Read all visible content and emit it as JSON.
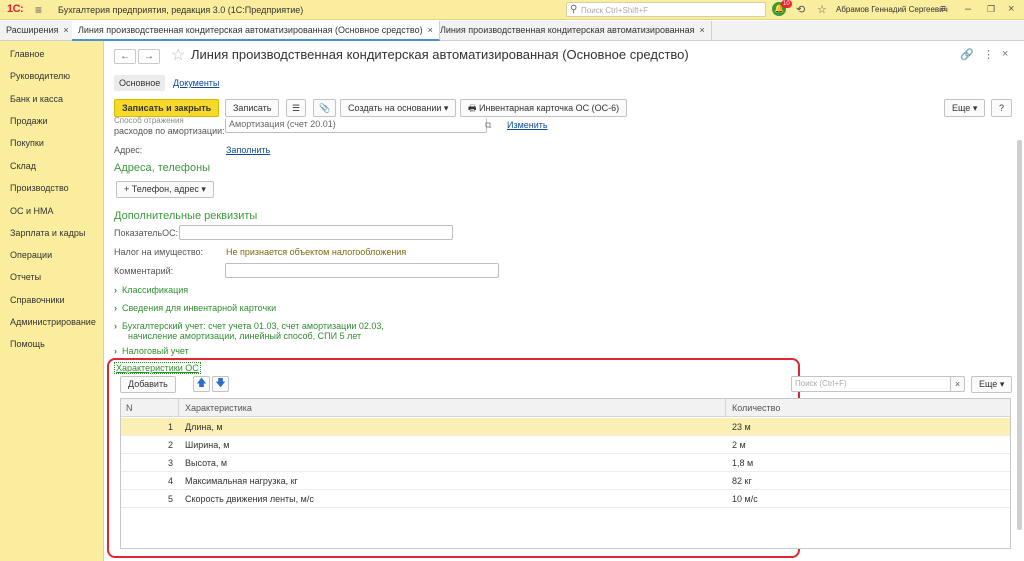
{
  "titlebar": {
    "logo": "1С:",
    "app_title": "Бухгалтерия предприятия, редакция 3.0  (1С:Предприятие)",
    "search_placeholder": "Поиск Ctrl+Shift+F",
    "notifications_count": "10",
    "user": "Абрамов Геннадий Сергеевич"
  },
  "tabs": [
    {
      "label": "Расширения"
    },
    {
      "label": "Линия производственная кондитерская автоматизированная (Основное средство)"
    },
    {
      "label": "Линия производственная кондитерская автоматизированная"
    }
  ],
  "sidebar": {
    "items": [
      {
        "label": "Главное"
      },
      {
        "label": "Руководителю"
      },
      {
        "label": "Банк и касса"
      },
      {
        "label": "Продажи"
      },
      {
        "label": "Покупки"
      },
      {
        "label": "Склад"
      },
      {
        "label": "Производство"
      },
      {
        "label": "ОС и НМА"
      },
      {
        "label": "Зарплата и кадры"
      },
      {
        "label": "Операции"
      },
      {
        "label": "Отчеты"
      },
      {
        "label": "Справочники"
      },
      {
        "label": "Администрирование"
      },
      {
        "label": "Помощь"
      }
    ]
  },
  "form": {
    "title": "Линия производственная кондитерская автоматизированная (Основное средство)",
    "subtabs": {
      "main": "Основное",
      "documents": "Документы"
    },
    "toolbar": {
      "save_close": "Записать и закрыть",
      "save": "Записать",
      "create_based": "Создать на основании",
      "inventory_card": "Инвентарная карточка ОС (ОС-6)",
      "more": "Еще",
      "help": "?"
    },
    "expense_label_line1": "Способ отражения",
    "expense_label_line2": "расходов по амортизации:",
    "expense_value": "Амортизация (счет 20.01)",
    "expense_change": "Изменить",
    "address_label": "Адрес:",
    "address_fill": "Заполнить",
    "contacts_section": "Адреса, телефоны",
    "phone_address_button": "+ Телефон, адрес",
    "extra_section": "Дополнительные реквизиты",
    "indicator_label": "ПоказательОС:",
    "indicator_value": "",
    "property_tax_label": "Налог на имущество:",
    "property_tax_value": "Не признается объектом налогообложения",
    "comment_label": "Комментарий:",
    "comment_value": "",
    "groups": [
      {
        "label": "Классификация"
      },
      {
        "label": "Сведения для инвентарной карточки"
      },
      {
        "label": "Бухгалтерский учет: счет учета 01.03, счет амортизации 02.03,",
        "label2": "начисление амортизации, линейный способ, СПИ 5 лет"
      },
      {
        "label": "Налоговый учет"
      }
    ],
    "characteristics": {
      "title": "Характеристики ОС",
      "add_button": "Добавить",
      "search_placeholder": "Поиск (Ctrl+F)",
      "clear": "×",
      "more": "Еще",
      "columns": {
        "n": "N",
        "name": "Характеристика",
        "qty": "Количество"
      },
      "rows": [
        {
          "n": "1",
          "name": "Длина, м",
          "qty": "23 м"
        },
        {
          "n": "2",
          "name": "Ширина, м",
          "qty": "2 м"
        },
        {
          "n": "3",
          "name": "Высота, м",
          "qty": "1,8 м"
        },
        {
          "n": "4",
          "name": "Максимальная нагрузка, кг",
          "qty": "82 кг"
        },
        {
          "n": "5",
          "name": "Скорость движения ленты, м/с",
          "qty": "10 м/с"
        }
      ]
    }
  },
  "colors": {
    "accent_yellow": "#f7d92b",
    "highlight_red": "#e0262f",
    "section_green": "#3c9a3c",
    "link_blue": "#0b4a9c"
  }
}
